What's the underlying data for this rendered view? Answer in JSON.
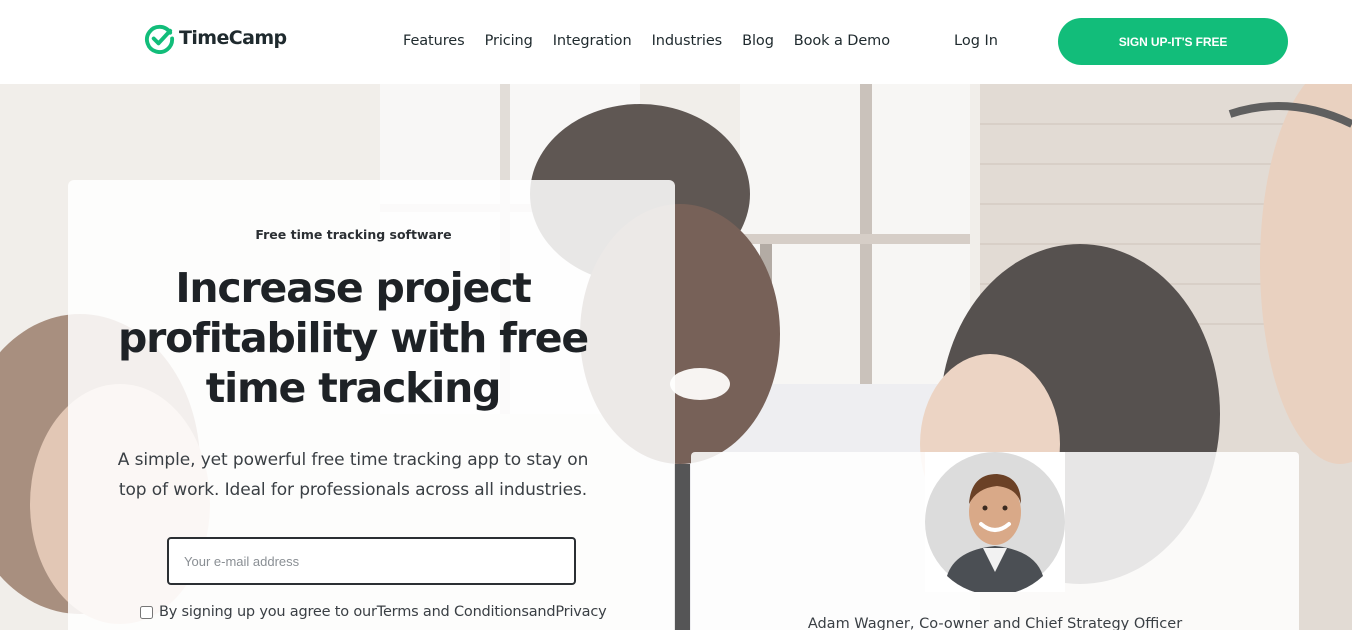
{
  "brand": {
    "name": "TimeCamp",
    "accent": "#12bd7a"
  },
  "nav": {
    "items": [
      "Features",
      "Pricing",
      "Integration",
      "Industries",
      "Blog",
      "Book a Demo"
    ],
    "login": "Log In",
    "signup": "SIGN UP-IT'S FREE"
  },
  "hero": {
    "eyebrow": "Free time tracking software",
    "headline": "Increase project profitability with free time tracking",
    "subhead": "A simple, yet powerful free time tracking app to stay on top of work. Ideal for professionals across all industries.",
    "email_placeholder": "Your e-mail address",
    "agree_text": "By signing up you agree to ourTerms and ConditionsandPrivacy"
  },
  "testimonial": {
    "name": "Adam Wagner, Co-owner and Chief Strategy Officer"
  },
  "icons": {
    "logo": "checkmark-circle-icon"
  }
}
